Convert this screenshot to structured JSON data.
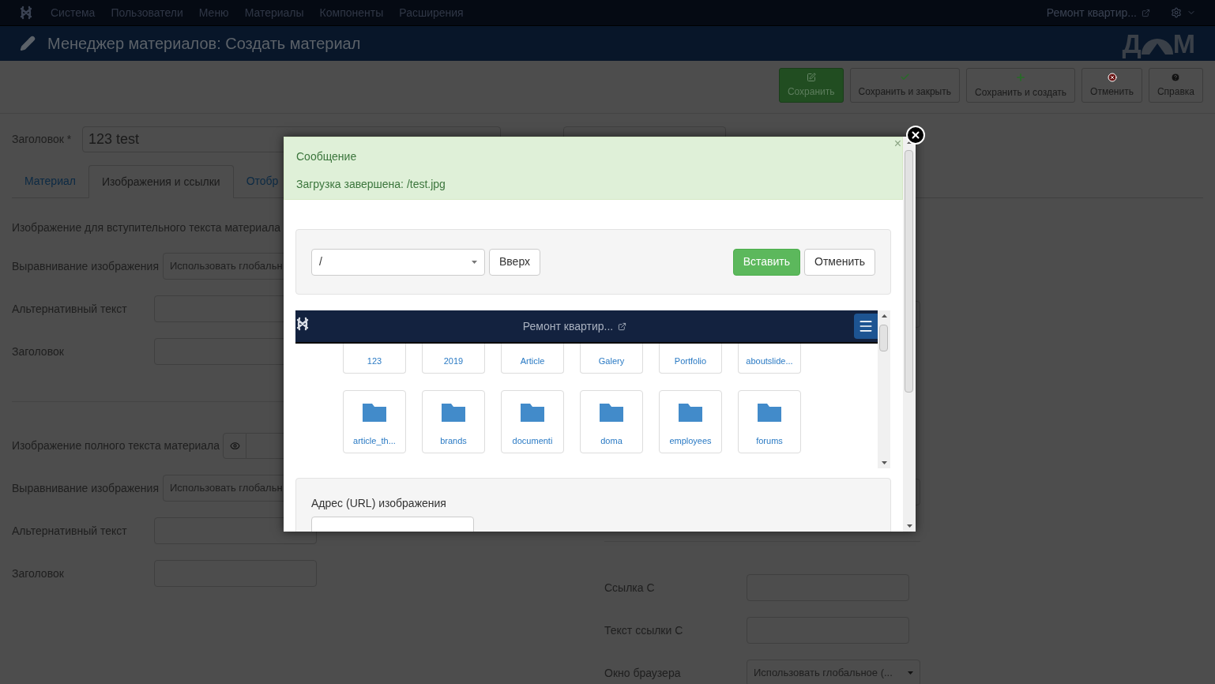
{
  "top_menu": {
    "items": [
      "Система",
      "Пользователи",
      "Меню",
      "Материалы",
      "Компоненты",
      "Расширения"
    ],
    "site_link": "Ремонт квартир..."
  },
  "header": {
    "title": "Менеджер материалов: Создать материал",
    "logo": [
      "Д",
      "М"
    ]
  },
  "toolbar": {
    "buttons": [
      {
        "label": "Сохранить",
        "kind": "save"
      },
      {
        "label": "Сохранить и закрыть",
        "kind": "save-close"
      },
      {
        "label": "Сохранить и создать",
        "kind": "save-new"
      },
      {
        "label": "Отменить",
        "kind": "cancel"
      },
      {
        "label": "Справка",
        "kind": "help"
      }
    ]
  },
  "title_field": {
    "label": "Заголовок *",
    "value": "123 test"
  },
  "tabs": [
    {
      "label": "Материал",
      "selected": false
    },
    {
      "label": "Изображения и ссылки",
      "selected": true
    },
    {
      "label": "Отобр",
      "selected": false
    }
  ],
  "intro_image": {
    "heading": "Изображение для вступительного текста материала",
    "fields": [
      {
        "kind": "select",
        "label": "Выравнивание изображения",
        "value": "Использовать глобальн"
      },
      {
        "kind": "input",
        "label": "Альтернативный текст"
      },
      {
        "kind": "input",
        "label": "Заголовок"
      }
    ]
  },
  "full_image": {
    "heading": "Изображение полного текста материала",
    "fields": [
      {
        "kind": "select",
        "label": "Выравнивание изображения",
        "value": "Использовать глобальн"
      },
      {
        "kind": "input",
        "label": "Альтернативный текст"
      },
      {
        "kind": "input",
        "label": "Заголовок"
      }
    ]
  },
  "links_c": {
    "fields": [
      {
        "kind": "input",
        "label": "Ссылка C"
      },
      {
        "kind": "input",
        "label": "Текст ссылки C"
      },
      {
        "kind": "select",
        "label": "Окно браузера",
        "value": "Использовать глобальное (..."
      }
    ]
  },
  "modal": {
    "message": {
      "title": "Сообщение",
      "text": "Загрузка завершена: /test.jpg",
      "close": "×"
    },
    "folder_select": {
      "value": "/"
    },
    "up_button": "Вверх",
    "insert_button": "Вставить",
    "cancel_button": "Отменить",
    "browser": {
      "site_link": "Ремонт квартир...",
      "folders_partial": [
        "123",
        "2019",
        "Article",
        "Galery",
        "Portfolio",
        "aboutslide..."
      ],
      "folders": [
        "article_th...",
        "brands",
        "documenti",
        "doma",
        "employees",
        "forums"
      ]
    },
    "url_field": {
      "label": "Адрес (URL) изображения"
    }
  }
}
